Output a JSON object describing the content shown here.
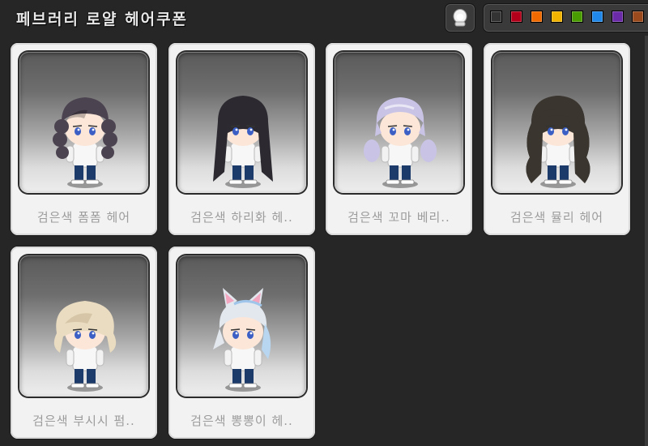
{
  "window": {
    "title": "페브러리 로얄 헤어쿠폰"
  },
  "palette": {
    "colors": [
      {
        "name": "black",
        "hex": "#333333"
      },
      {
        "name": "red",
        "hex": "#b3001a"
      },
      {
        "name": "orange",
        "hex": "#f06a00"
      },
      {
        "name": "yellow",
        "hex": "#f2b300"
      },
      {
        "name": "green",
        "hex": "#4a9d00"
      },
      {
        "name": "blue",
        "hex": "#1f88e8"
      },
      {
        "name": "purple",
        "hex": "#6b2ba8"
      },
      {
        "name": "brown",
        "hex": "#9a4a1c"
      }
    ]
  },
  "items": [
    {
      "label": "검은색 폼폼 헤어",
      "hair_color": "#4c4350",
      "style": "pigtail-curls"
    },
    {
      "label": "검은색 하리화 헤..",
      "hair_color": "#2c2a30",
      "style": "long-straight"
    },
    {
      "label": "검은색 꼬마 베리..",
      "hair_color": "#c9c4e6",
      "style": "low-pigtails"
    },
    {
      "label": "검은색 뮬리 헤어",
      "hair_color": "#3a352f",
      "style": "long-wavy"
    },
    {
      "label": "검은색 부시시 펌..",
      "hair_color": "#e9dcc0",
      "style": "fluffy-short"
    },
    {
      "label": "검은색 뽕뽕이 헤..",
      "hair_color": "#e3e8ef",
      "style": "cat-ears"
    }
  ],
  "icons": {
    "preview": "character-head-icon"
  }
}
